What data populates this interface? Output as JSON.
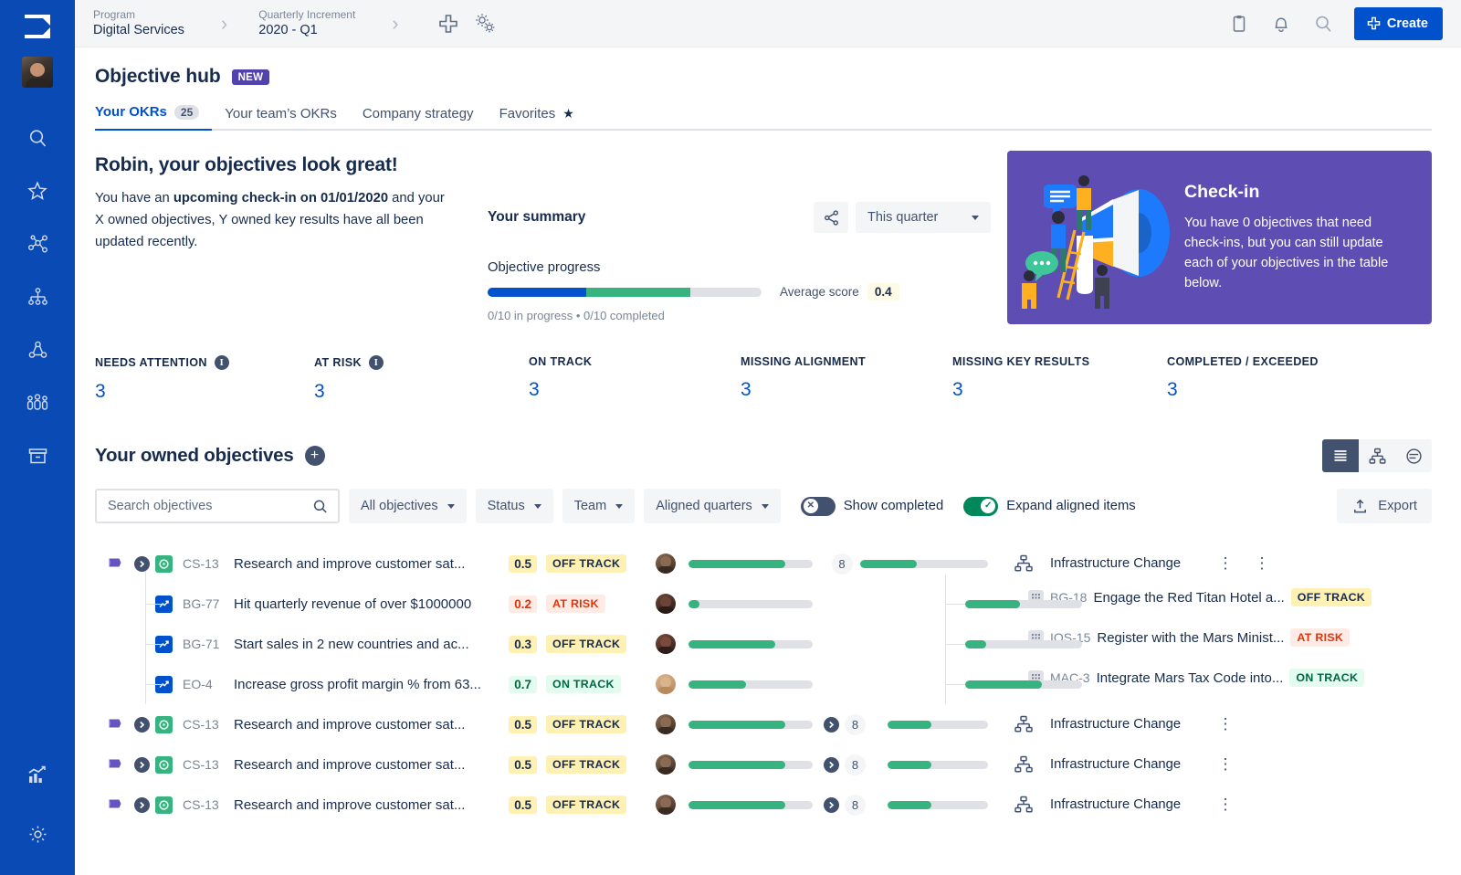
{
  "topbar": {
    "breadcrumbs": [
      {
        "label": "Program",
        "value": "Digital Services"
      },
      {
        "label": "Quarterly Increment",
        "value": "2020 - Q1"
      }
    ],
    "separator": "›",
    "add_icon": "plus-icon",
    "settings_icon": "gears-icon",
    "clipboard_icon": "clipboard-icon",
    "bell_icon": "notifications-bell-icon",
    "search_icon": "search-icon",
    "create_label": "Create"
  },
  "rail": {
    "logo_icon": "app-logo-icon",
    "avatar": "user-avatar",
    "items": [
      {
        "icon": "search-icon",
        "name": "rail-search"
      },
      {
        "icon": "star-icon",
        "name": "rail-favorites"
      },
      {
        "icon": "network-icon",
        "name": "rail-dependencies"
      },
      {
        "icon": "hierarchy-icon",
        "name": "rail-hierarchy"
      },
      {
        "icon": "roadmap-nodes-icon",
        "name": "rail-program"
      },
      {
        "icon": "people-icon",
        "name": "rail-teams"
      },
      {
        "icon": "archive-box-icon",
        "name": "rail-archive"
      }
    ],
    "bottom_items": [
      {
        "icon": "chart-bar-icon",
        "name": "rail-reports"
      },
      {
        "icon": "gear-icon",
        "name": "rail-settings"
      }
    ]
  },
  "page": {
    "title": "Objective hub",
    "badge": "NEW",
    "tabs": [
      {
        "label": "Your OKRs",
        "count": "25",
        "active": true
      },
      {
        "label": "Your team’s OKRs",
        "active": false
      },
      {
        "label": "Company strategy",
        "active": false
      },
      {
        "label": "Favorites",
        "active": false,
        "star": "★"
      }
    ]
  },
  "hero": {
    "heading": "Robin, your objectives look great!",
    "body_pre": "You have an ",
    "body_bold": "upcoming check-in on 01/01/2020",
    "body_post": " and your X owned objectives, Y owned key results have all been updated recently."
  },
  "summary": {
    "title": "Your summary",
    "share_icon": "share-icon",
    "period": "This quarter",
    "progress_label": "Objective progress",
    "avg_label": "Average score",
    "avg_value": "0.4",
    "sub_text": "0/10 in progress • 0/10 completed",
    "bar_blue_pct": 36,
    "bar_green_pct": 38
  },
  "checkin": {
    "illustration": "megaphone-illustration",
    "title": "Check-in",
    "body": "You have 0 objectives that need check-ins, but you can still update each of your objectives in the table below.",
    "bg_color": "#5e4db2"
  },
  "stats": [
    {
      "label": "NEEDS ATTENTION",
      "value": "3",
      "info": true
    },
    {
      "label": "AT RISK",
      "value": "3",
      "info": true
    },
    {
      "label": "ON TRACK",
      "value": "3",
      "info": false
    },
    {
      "label": "MISSING ALIGNMENT",
      "value": "3",
      "info": false
    },
    {
      "label": "MISSING KEY RESULTS",
      "value": "3",
      "info": false
    },
    {
      "label": "COMPLETED / EXCEEDED",
      "value": "3",
      "info": false
    }
  ],
  "objectives_section": {
    "title": "Your owned objectives",
    "add_icon": "plus-circle-icon",
    "views": [
      {
        "icon": "list-view-icon",
        "name": "view-list",
        "active": true
      },
      {
        "icon": "tree-view-icon",
        "name": "view-tree",
        "active": false
      },
      {
        "icon": "timeline-view-icon",
        "name": "view-timeline",
        "active": false
      }
    ],
    "search_placeholder": "Search objectives",
    "search_value": "",
    "filters": [
      {
        "label": "All objectives",
        "name": "filter-all-objectives"
      },
      {
        "label": "Status",
        "name": "filter-status"
      },
      {
        "label": "Team",
        "name": "filter-team"
      },
      {
        "label": "Aligned quarters",
        "name": "filter-aligned-quarters"
      }
    ],
    "toggles": [
      {
        "label": "Show completed",
        "on": false,
        "mark": "✕"
      },
      {
        "label": "Expand aligned items",
        "on": true,
        "mark": "✓"
      }
    ],
    "export_label": "Export",
    "export_icon": "export-upload-icon"
  },
  "table": {
    "rows": [
      {
        "kind": "objective",
        "flag": true,
        "expanded": true,
        "key": "CS-13",
        "name": "Research and improve customer sat...",
        "score": "0.5",
        "score_class": "sc-off",
        "status": "OFF TRACK",
        "status_class": "st-off",
        "progress": 78,
        "align_count": "8",
        "align_progress": 44,
        "team": "Infrastructure Change",
        "team_icon": "hierarchy-icon",
        "extra_dots": true,
        "children": [
          {
            "kind": "kr",
            "key": "BG-77",
            "name": "Hit quarterly revenue of over $1000000",
            "score": "0.2",
            "score_class": "sc-risk",
            "status": "AT RISK",
            "status_class": "st-risk",
            "progress": 9
          },
          {
            "kind": "kr",
            "key": "BG-71",
            "name": "Start sales in 2 new countries and ac...",
            "score": "0.3",
            "score_class": "sc-off",
            "status": "OFF TRACK",
            "status_class": "st-off",
            "progress": 70
          },
          {
            "kind": "kr",
            "key": "EO-4",
            "name": "Increase gross profit margin % from 63...",
            "score": "0.7",
            "score_class": "sc-on",
            "status": "ON TRACK",
            "status_class": "st-on",
            "progress": 46
          }
        ],
        "aligned": [
          {
            "key": "BG-18",
            "name": "Engage the Red Titan Hotel a...",
            "status": "OFF TRACK",
            "status_class": "st-off",
            "progress": 47
          },
          {
            "key": "IOS-15",
            "name": "Register with the Mars Minist...",
            "status": "AT RISK",
            "status_class": "st-risk",
            "progress": 18
          },
          {
            "key": "MAC-3",
            "name": "Integrate Mars Tax Code into...",
            "status": "ON TRACK",
            "status_class": "st-on",
            "progress": 66
          }
        ]
      },
      {
        "kind": "objective",
        "flag": true,
        "expanded": false,
        "key": "CS-13",
        "name": "Research and improve customer sat...",
        "score": "0.5",
        "score_class": "sc-off",
        "status": "OFF TRACK",
        "status_class": "st-off",
        "progress": 78,
        "align_count": "8",
        "align_progress": 44,
        "align_expandable": true,
        "team": "Infrastructure Change",
        "team_icon": "hierarchy-icon",
        "children": [],
        "aligned": []
      },
      {
        "kind": "objective",
        "flag": true,
        "expanded": false,
        "key": "CS-13",
        "name": "Research and improve customer sat...",
        "score": "0.5",
        "score_class": "sc-off",
        "status": "OFF TRACK",
        "status_class": "st-off",
        "progress": 78,
        "align_count": "8",
        "align_progress": 44,
        "align_expandable": true,
        "team": "Infrastructure Change",
        "team_icon": "hierarchy-icon",
        "children": [],
        "aligned": []
      },
      {
        "kind": "objective",
        "flag": true,
        "expanded": false,
        "key": "CS-13",
        "name": "Research and improve customer sat...",
        "score": "0.5",
        "score_class": "sc-off",
        "status": "OFF TRACK",
        "status_class": "st-off",
        "progress": 78,
        "align_count": "8",
        "align_progress": 44,
        "align_expandable": true,
        "team": "Infrastructure Change",
        "team_icon": "hierarchy-icon",
        "children": [],
        "aligned": []
      }
    ]
  },
  "colors": {
    "brand_blue": "#0052cc",
    "rail_blue": "#0a4ab5",
    "green": "#36b37e",
    "purple": "#5e4db2",
    "text": "#172b4d",
    "subtle": "#7a869a"
  }
}
